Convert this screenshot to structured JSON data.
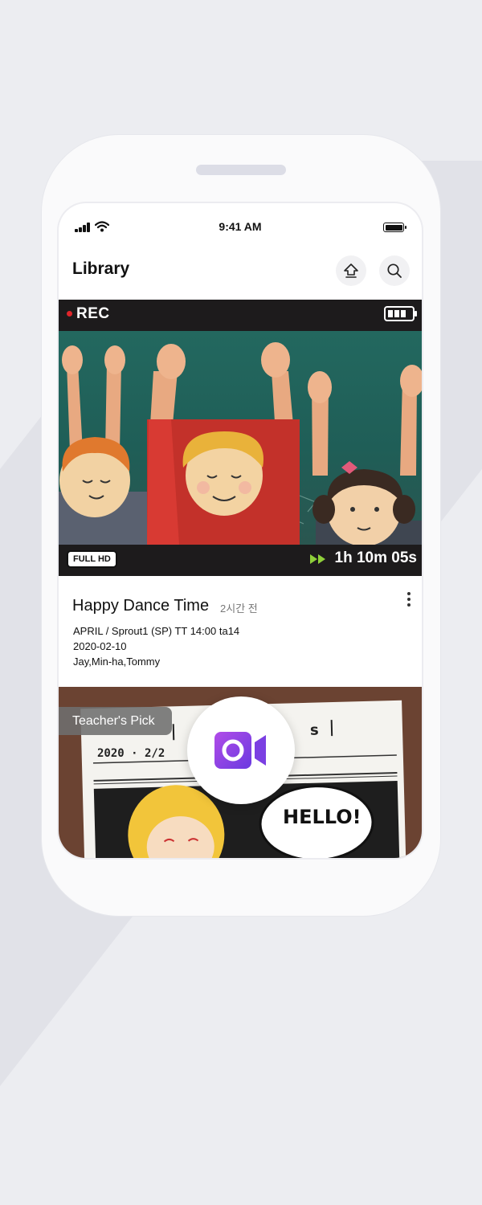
{
  "status_bar": {
    "time": "9:41 AM"
  },
  "header": {
    "title": "Library",
    "home_icon": "home-upload-icon",
    "search_icon": "search-icon"
  },
  "video": {
    "rec_label": "REC",
    "quality_badge": "FULL HD",
    "duration": "1h 10m 05s",
    "colors": {
      "rec_dot": "#e0252a",
      "fast_forward": "#8fd03a"
    }
  },
  "item": {
    "title": "Happy Dance Time",
    "time_ago": "2시간 전",
    "class_line": "APRIL / Sprout1 (SP) TT 14:00 ta14",
    "date": "2020-02-10",
    "students": "Jay,Min-ha,Tommy"
  },
  "card2": {
    "badge": "Teacher's Pick",
    "paper_date": "2020 · 2/2",
    "speech_bubble": "HELLO!",
    "fab_icon": "video-camera-icon",
    "accent": "#8a3fe0"
  }
}
